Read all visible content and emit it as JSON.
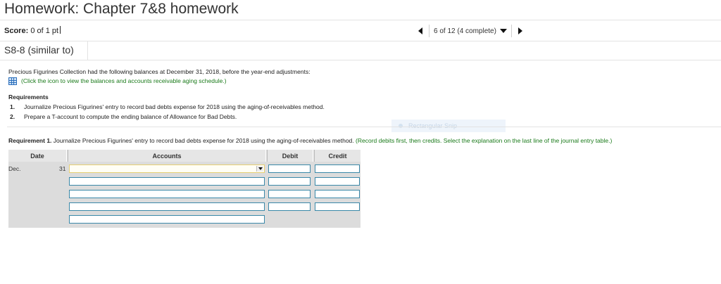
{
  "header": {
    "title": "Homework: Chapter 7&8 homework"
  },
  "score": {
    "label": "Score:",
    "value": "0 of 1 pt"
  },
  "nav": {
    "position": "6 of 12 (4 complete)"
  },
  "question": {
    "id": "S8-8 (similar to)"
  },
  "content": {
    "intro": "Precious Figurines Collection had the following balances at December 31, 2018, before the year-end adjustments:",
    "icon_link": "(Click the icon to view the balances and accounts receivable aging schedule.)",
    "requirements_heading": "Requirements",
    "requirements": [
      {
        "num": "1.",
        "text": "Journalize Precious Figurines' entry to record bad debts expense for 2018 using the aging-of-receivables method."
      },
      {
        "num": "2.",
        "text": "Prepare a T-account to compute the ending balance of Allowance for Bad Debts."
      }
    ],
    "snip_label": "Rectangular Snip",
    "req1_bold": "Requirement 1.",
    "req1_text": "Journalize Precious Figurines' entry to record bad debts expense for 2018 using the aging-of-receivables method.",
    "req1_hint": "(Record debits first, then credits. Select the explanation on the last line of the journal entry table.)"
  },
  "journal": {
    "headers": {
      "date": "Date",
      "accounts": "Accounts",
      "debit": "Debit",
      "credit": "Credit"
    },
    "month": "Dec.",
    "day": "31"
  }
}
